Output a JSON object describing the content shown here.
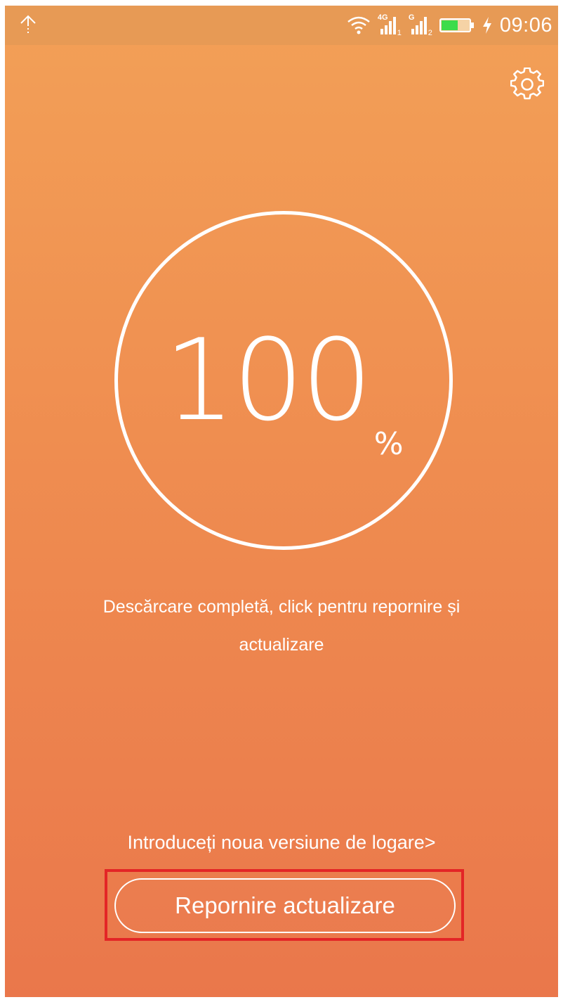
{
  "status_bar": {
    "time": "09:06",
    "sim1_network": "4G",
    "sim1_slot": "1",
    "sim2_network": "G",
    "sim2_slot": "2",
    "battery_color": "#3ddc4a",
    "icons": [
      "upload-arrow-icon",
      "wifi-icon",
      "signal-icon",
      "signal-icon",
      "battery-icon",
      "charging-bolt-icon"
    ]
  },
  "header": {
    "settings_icon": "gear-icon"
  },
  "progress": {
    "value": "100",
    "unit": "%"
  },
  "message": "Descărcare completă, click pentru repornire și actualizare",
  "changelog_link": "Introduceți noua versiune de logare>",
  "restart_button": {
    "label": "Repornire actualizare"
  },
  "colors": {
    "gradient_top": "#f3a057",
    "gradient_bottom": "#ea774b",
    "highlight": "#e32526"
  }
}
